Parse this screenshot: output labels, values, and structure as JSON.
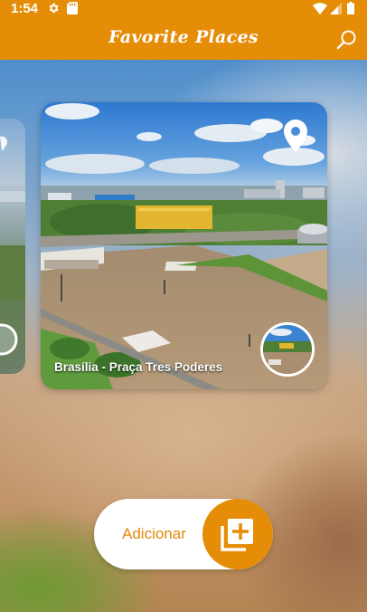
{
  "status_bar": {
    "time": "1:54",
    "icons": [
      "gear-icon",
      "sd-card-icon",
      "wifi-icon",
      "signal-icon",
      "battery-icon"
    ]
  },
  "app_bar": {
    "title": "Favorite Places",
    "search_icon": "search-icon"
  },
  "colors": {
    "primary": "#e58d07",
    "on_primary": "#ffffff",
    "button_text": "#e08a07"
  },
  "carousel": {
    "current": {
      "title": "Brasília - Praça Tres Poderes",
      "pin_icon": "location-pin-icon"
    }
  },
  "fab": {
    "label": "Adicionar",
    "icon": "add-library-icon"
  }
}
